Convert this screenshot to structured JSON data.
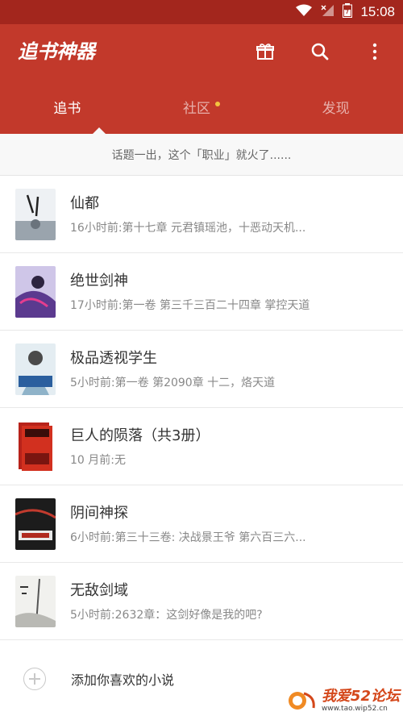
{
  "status_bar": {
    "time": "15:08"
  },
  "app": {
    "title": "追书神器"
  },
  "tabs": [
    {
      "label": "追书",
      "active": true
    },
    {
      "label": "社区",
      "has_dot": true
    },
    {
      "label": "发现"
    }
  ],
  "banner": {
    "text": "话题一出，这个「职业」就火了......"
  },
  "books": [
    {
      "title": "仙都",
      "subtitle": "16小时前:第十七章 元君镇瑶池，十恶动天机..."
    },
    {
      "title": "绝世剑神",
      "subtitle": "17小时前:第一卷 第三千三百二十四章 掌控天道"
    },
    {
      "title": "极品透视学生",
      "subtitle": "5小时前:第一卷 第2090章 十二，烙天道"
    },
    {
      "title": "巨人的陨落（共3册）",
      "subtitle": "10 月前:无"
    },
    {
      "title": "阴间神探",
      "subtitle": "6小时前:第三十三卷: 决战景王爷 第六百三六..."
    },
    {
      "title": "无敌剑域",
      "subtitle": "5小时前:2632章：这剑好像是我的吧?"
    }
  ],
  "add_row": {
    "label": "添加你喜欢的小说"
  },
  "watermark": {
    "main": "我爱52论坛",
    "url": "www.tao.wip52.cn"
  },
  "colors": {
    "status_bar": "#a3261d",
    "app_bar": "#c2392b",
    "tab_dot": "#f3c340"
  }
}
